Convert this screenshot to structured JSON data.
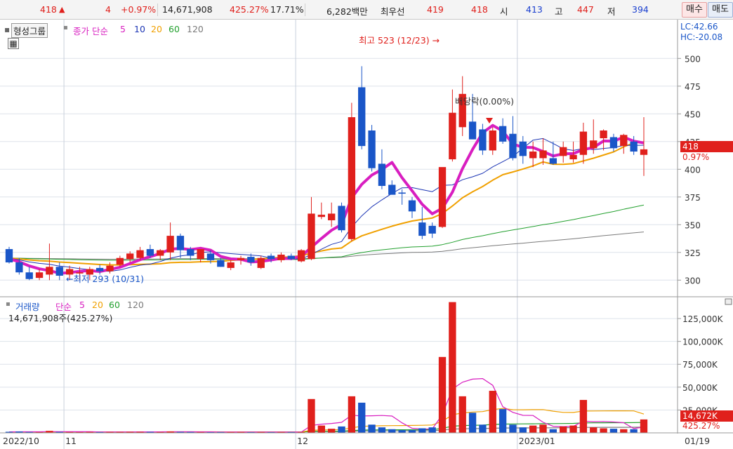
{
  "quote_bar": {
    "price": "418",
    "arrow": "▲",
    "change": "4",
    "change_pct": "+0.97%",
    "volume": "14,671,908",
    "volume_ratio": "425.27%",
    "turnover_pct": "17.71%",
    "trade_value": "6,282백만",
    "best_label": "최우선",
    "best_ask": "419",
    "best_bid": "418",
    "open_label": "시",
    "open": "413",
    "high_label": "고",
    "high": "447",
    "low_label": "저",
    "low": "394",
    "buy_button": "매수",
    "sell_button": "매도"
  },
  "price_panel": {
    "stock_name": "형성그룹",
    "ma_label": "종가 단순",
    "ma_periods": [
      "5",
      "10",
      "20",
      "60",
      "120"
    ],
    "lc_label": "LC:42.66",
    "hc_label": "HC:-20.08",
    "high_annotation": "최고 523 (12/23) →",
    "low_annotation": "←최저 293 (10/31)",
    "dividend_annotation": "배당락(0.00%)",
    "current_price_tag": "418",
    "current_change_tag": "0.97%",
    "y_ticks": [
      "500",
      "475",
      "450",
      "425",
      "400",
      "375",
      "350",
      "325",
      "300"
    ]
  },
  "volume_panel": {
    "label": "거래량",
    "ma_label": "단순",
    "ma_periods": [
      "5",
      "20",
      "60",
      "120"
    ],
    "summary": "14,671,908주(425.27%)",
    "y_ticks": [
      "125,000K",
      "100,000K",
      "75,000K",
      "50,000K",
      "25,000K"
    ],
    "current_volume_tag": "14,672K",
    "current_ratio_tag": "425.27%"
  },
  "x_axis": {
    "labels": [
      "2022/10",
      "11",
      "12",
      "2023/01",
      "01/19"
    ]
  },
  "colors": {
    "up": "#e0201c",
    "down": "#1a56c8",
    "ma5": "#d81ec0",
    "ma10": "#1c35b4",
    "ma20": "#f0a000",
    "ma60": "#22a02e",
    "ma120": "#7a7a7a"
  },
  "chart_data": {
    "type": "candlestick",
    "price_ylim": [
      285,
      535
    ],
    "volume_ylim": [
      0,
      145000000
    ],
    "candles": [
      {
        "o": 328,
        "h": 330,
        "l": 315,
        "c": 316
      },
      {
        "o": 316,
        "h": 320,
        "l": 305,
        "c": 307
      },
      {
        "o": 307,
        "h": 312,
        "l": 300,
        "c": 301
      },
      {
        "o": 302,
        "h": 310,
        "l": 300,
        "c": 307
      },
      {
        "o": 305,
        "h": 333,
        "l": 300,
        "c": 312
      },
      {
        "o": 312,
        "h": 316,
        "l": 300,
        "c": 304
      },
      {
        "o": 305,
        "h": 313,
        "l": 300,
        "c": 310
      },
      {
        "o": 306,
        "h": 312,
        "l": 300,
        "c": 307
      },
      {
        "o": 305,
        "h": 312,
        "l": 300,
        "c": 310
      },
      {
        "o": 311,
        "h": 314,
        "l": 305,
        "c": 308
      },
      {
        "o": 308,
        "h": 316,
        "l": 306,
        "c": 313
      },
      {
        "o": 314,
        "h": 322,
        "l": 312,
        "c": 320
      },
      {
        "o": 319,
        "h": 326,
        "l": 316,
        "c": 324
      },
      {
        "o": 320,
        "h": 330,
        "l": 318,
        "c": 327
      },
      {
        "o": 328,
        "h": 332,
        "l": 320,
        "c": 322
      },
      {
        "o": 322,
        "h": 328,
        "l": 318,
        "c": 327
      },
      {
        "o": 325,
        "h": 352,
        "l": 318,
        "c": 340
      },
      {
        "o": 340,
        "h": 342,
        "l": 320,
        "c": 327
      },
      {
        "o": 328,
        "h": 330,
        "l": 318,
        "c": 322
      },
      {
        "o": 319,
        "h": 328,
        "l": 316,
        "c": 328
      },
      {
        "o": 324,
        "h": 327,
        "l": 315,
        "c": 318
      },
      {
        "o": 318,
        "h": 320,
        "l": 312,
        "c": 312
      },
      {
        "o": 311,
        "h": 318,
        "l": 309,
        "c": 316
      },
      {
        "o": 318,
        "h": 322,
        "l": 314,
        "c": 320
      },
      {
        "o": 321,
        "h": 324,
        "l": 313,
        "c": 316
      },
      {
        "o": 311,
        "h": 322,
        "l": 310,
        "c": 320
      },
      {
        "o": 322,
        "h": 324,
        "l": 316,
        "c": 319
      },
      {
        "o": 318,
        "h": 325,
        "l": 316,
        "c": 323
      },
      {
        "o": 322,
        "h": 324,
        "l": 318,
        "c": 319
      },
      {
        "o": 317,
        "h": 328,
        "l": 316,
        "c": 327
      },
      {
        "o": 319,
        "h": 375,
        "l": 318,
        "c": 360
      },
      {
        "o": 357,
        "h": 370,
        "l": 355,
        "c": 359
      },
      {
        "o": 354,
        "h": 370,
        "l": 348,
        "c": 360
      },
      {
        "o": 367,
        "h": 370,
        "l": 343,
        "c": 345
      },
      {
        "o": 337,
        "h": 460,
        "l": 335,
        "c": 447
      },
      {
        "o": 474,
        "h": 493,
        "l": 418,
        "c": 421
      },
      {
        "o": 435,
        "h": 440,
        "l": 398,
        "c": 401
      },
      {
        "o": 405,
        "h": 418,
        "l": 382,
        "c": 385
      },
      {
        "o": 386,
        "h": 390,
        "l": 378,
        "c": 377
      },
      {
        "o": 379,
        "h": 382,
        "l": 368,
        "c": 378
      },
      {
        "o": 372,
        "h": 375,
        "l": 356,
        "c": 362
      },
      {
        "o": 352,
        "h": 366,
        "l": 337,
        "c": 340
      },
      {
        "o": 349,
        "h": 352,
        "l": 338,
        "c": 342
      },
      {
        "o": 348,
        "h": 382,
        "l": 347,
        "c": 402
      },
      {
        "o": 409,
        "h": 472,
        "l": 407,
        "c": 451
      },
      {
        "o": 438,
        "h": 484,
        "l": 430,
        "c": 468
      },
      {
        "o": 443,
        "h": 468,
        "l": 430,
        "c": 427
      },
      {
        "o": 436,
        "h": 441,
        "l": 413,
        "c": 417
      },
      {
        "o": 417,
        "h": 438,
        "l": 413,
        "c": 435
      },
      {
        "o": 439,
        "h": 446,
        "l": 423,
        "c": 425
      },
      {
        "o": 432,
        "h": 448,
        "l": 408,
        "c": 410
      },
      {
        "o": 425,
        "h": 430,
        "l": 405,
        "c": 412
      },
      {
        "o": 410,
        "h": 425,
        "l": 402,
        "c": 416
      },
      {
        "o": 410,
        "h": 428,
        "l": 404,
        "c": 417
      },
      {
        "o": 410,
        "h": 425,
        "l": 404,
        "c": 405
      },
      {
        "o": 412,
        "h": 425,
        "l": 406,
        "c": 420
      },
      {
        "o": 409,
        "h": 425,
        "l": 406,
        "c": 413
      },
      {
        "o": 413,
        "h": 442,
        "l": 405,
        "c": 434
      },
      {
        "o": 419,
        "h": 445,
        "l": 414,
        "c": 426
      },
      {
        "o": 428,
        "h": 436,
        "l": 417,
        "c": 435
      },
      {
        "o": 429,
        "h": 432,
        "l": 416,
        "c": 419
      },
      {
        "o": 421,
        "h": 432,
        "l": 414,
        "c": 431
      },
      {
        "o": 425,
        "h": 430,
        "l": 413,
        "c": 416
      },
      {
        "o": 413,
        "h": 447,
        "l": 394,
        "c": 418
      }
    ],
    "volumes": [
      1200000,
      1500000,
      1000000,
      900000,
      2200000,
      1100000,
      1000000,
      900000,
      1100000,
      900000,
      1000000,
      1000000,
      1100000,
      1200000,
      1100000,
      1000000,
      1500000,
      1100000,
      1000000,
      900000,
      800000,
      900000,
      800000,
      900000,
      800000,
      900000,
      800000,
      900000,
      900000,
      900000,
      37000000,
      8000000,
      4500000,
      7000000,
      40000000,
      33000000,
      9000000,
      6000000,
      4000000,
      3000000,
      3000000,
      5000000,
      6000000,
      83000000,
      143000000,
      40000000,
      22000000,
      9000000,
      46000000,
      26000000,
      9000000,
      6000000,
      8000000,
      9000000,
      4000000,
      7000000,
      8000000,
      36000000,
      6000000,
      5000000,
      4500000,
      4000000,
      4000000,
      14672000
    ]
  }
}
